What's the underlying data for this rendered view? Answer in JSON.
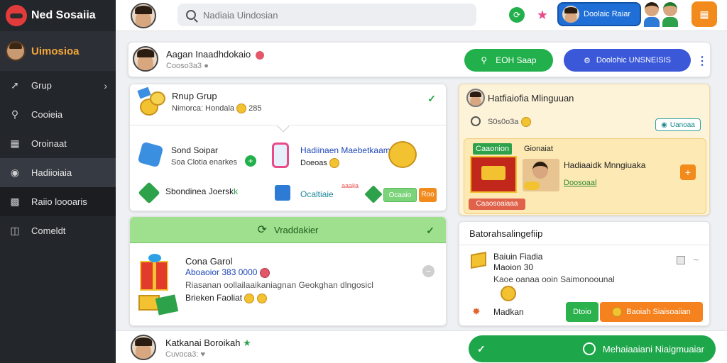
{
  "brand": {
    "name": "Ned Sosaiia"
  },
  "sidebar": {
    "user": "Uimosioa",
    "items": [
      {
        "label": "Grup",
        "icon": "arrow-icon"
      },
      {
        "label": "Cooieia",
        "icon": "search-icon"
      },
      {
        "label": "Oroinaat",
        "icon": "grid-icon"
      },
      {
        "label": "Hadiioiaia",
        "icon": "camera-icon"
      },
      {
        "label": "Raiio loooaris",
        "icon": "folder-icon"
      },
      {
        "label": "Comeldt",
        "icon": "building-icon"
      }
    ]
  },
  "topbar": {
    "search_placeholder": "Nadiaia Uindosian",
    "profile_label": "Doolaic Raiar"
  },
  "post": {
    "name": "Aagan Inaadhdokaio",
    "sub": "Cooso3a3",
    "btn_green": "EOH Saap",
    "btn_blue": "Doolohic UNSNEISIS"
  },
  "group_card": {
    "title": "Rnup Grup",
    "sub": "Nimorca: Hondala",
    "sub_count": "285",
    "items": [
      {
        "label": "Sond Soipar",
        "sub": "Soa Clotia enarkes"
      },
      {
        "label": "Hadiinaen Maebetkaamk",
        "sub": "Doeoas"
      },
      {
        "label": "Sbondinea Joersk"
      },
      {
        "label": "Ocaltiaie"
      },
      {
        "label": "aaaiia"
      }
    ],
    "badge_green": "Ocaaio",
    "badge_orange": "Roo"
  },
  "vw_card": {
    "header": "Vraddakier",
    "title": "Cona Garol",
    "price": "Aboaoior 383 0000",
    "desc": "Riasanan oollailaaikaniagnan Geokghan dlngosicl",
    "foot": "Brieken Faoliat"
  },
  "hm_card": {
    "title": "Hatfiaiofia Mlinguuan",
    "sub": "S0s0o3a",
    "pill": "Uanoaa",
    "label_a": "Caaonion",
    "label_b": "Gionaiat",
    "t1": "Hadiaaidk Mnngiuaka",
    "t2": "Doosoaal",
    "red_bar": "Caaosoaiaaa"
  },
  "bt_card": {
    "title": "Batorahsalingefiip",
    "item_a": "Baiuin Fiadia",
    "item_b": "Maoion 30",
    "item_c": "Kaoe oanaa ooin Saimonoounal",
    "foot": "Madkan",
    "btn_green": "Dtoio",
    "btn_orange": "Baoiah Siaisoaiian"
  },
  "bottom": {
    "name": "Katkanai Boroikah",
    "sub": "Cuvoca3:",
    "btn": "Mehaiaaiani Niaigmuaiar"
  }
}
